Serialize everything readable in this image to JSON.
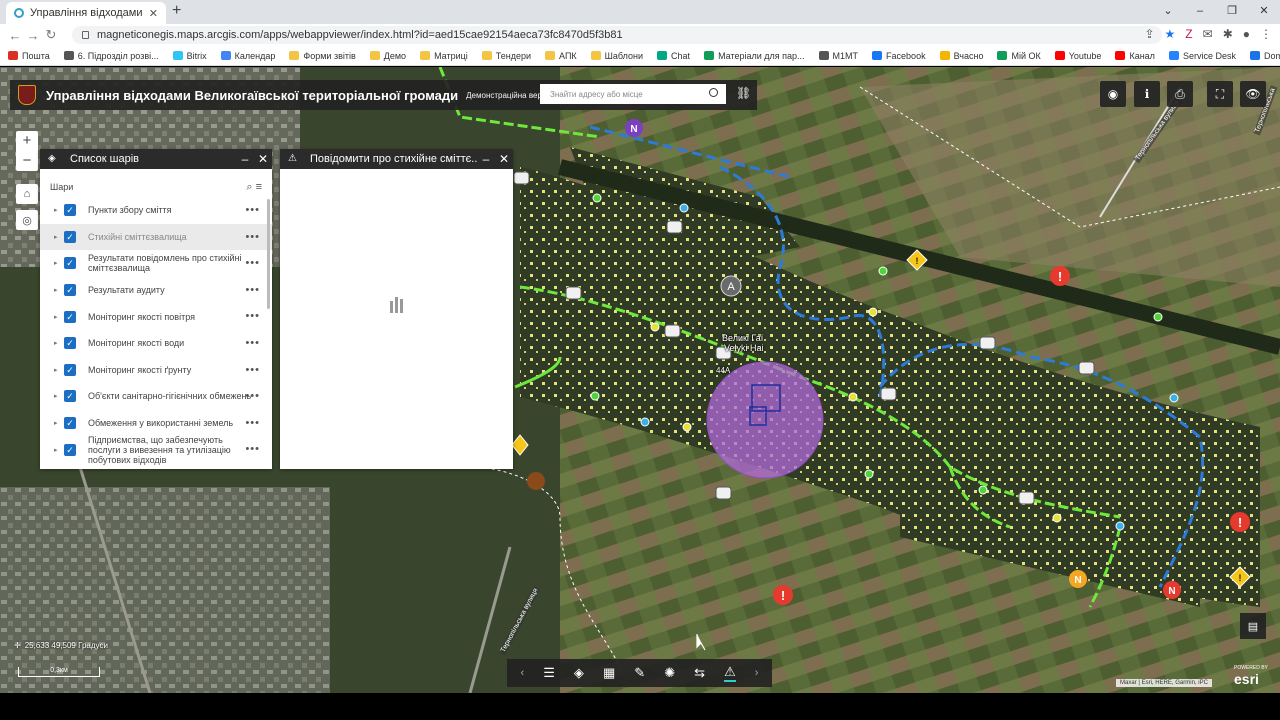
{
  "browser": {
    "tab_title": "Управління відходами Великога",
    "url": "magneticonegis.maps.arcgis.com/apps/webappviewer/index.html?id=aed15cae92154aeca73fc8470d5f3b81",
    "bookmarks": [
      {
        "label": "Пошта",
        "color": "#d93025"
      },
      {
        "label": "6. Підрозділ розві...",
        "color": "#555"
      },
      {
        "label": "Bitrix",
        "color": "#2fc6f6"
      },
      {
        "label": "Календар",
        "color": "#4285f4"
      },
      {
        "label": "Форми звітів",
        "color": "#f4c542"
      },
      {
        "label": "Демо",
        "color": "#f4c542"
      },
      {
        "label": "Матриці",
        "color": "#f4c542"
      },
      {
        "label": "Тендери",
        "color": "#f4c542"
      },
      {
        "label": "АПК",
        "color": "#f4c542"
      },
      {
        "label": "Шаблони",
        "color": "#f4c542"
      },
      {
        "label": "Chat",
        "color": "#00a884"
      },
      {
        "label": "Матеріали для пар...",
        "color": "#0f9d58"
      },
      {
        "label": "M1MT",
        "color": "#555"
      },
      {
        "label": "Facebook",
        "color": "#1877f2"
      },
      {
        "label": "Вчасно",
        "color": "#f4b400"
      },
      {
        "label": "Мій ОК",
        "color": "#0f9d58"
      },
      {
        "label": "Youtube",
        "color": "#ff0000"
      },
      {
        "label": "Канал",
        "color": "#ff0000"
      },
      {
        "label": "Service Desk",
        "color": "#2684ff"
      },
      {
        "label": "Domoticz",
        "color": "#1a73e8"
      }
    ]
  },
  "app": {
    "title": "Управління відходами Великогаївської територіальної громади",
    "subtitle": "Демонстраційна версія",
    "search_placeholder": "Знайти адресу або місце"
  },
  "layer_panel": {
    "title": "Список шарів",
    "section_label": "Шари",
    "layers": [
      {
        "label": "Пункти збору сміття",
        "dim": false
      },
      {
        "label": "Стихійні сміттєзвалища",
        "dim": true
      },
      {
        "label": "Результати повідомлень про стихійні сміттєзвалища",
        "dim": false
      },
      {
        "label": "Результати аудиту",
        "dim": false
      },
      {
        "label": "Моніторинг якості повітря",
        "dim": false
      },
      {
        "label": "Моніторинг якості води",
        "dim": false
      },
      {
        "label": "Моніторинг якості ґрунту",
        "dim": false
      },
      {
        "label": "Об'єкти санітарно-гігієнічних обмежень",
        "dim": false
      },
      {
        "label": "Обмеження у використанні земель",
        "dim": false
      },
      {
        "label": "Підприємства, що забезпечують послуги з вивезення та утилізацію побутових відходів",
        "dim": false
      }
    ]
  },
  "report_panel": {
    "title": "Повідомити про стихійне сміттє..."
  },
  "map": {
    "place_label_ua": "Великі Гаї",
    "place_label_en": "Velyki Hai",
    "building_label": "44А",
    "road_label_1": "Тернопільська вулиця",
    "road_label_2": "Тернопільська вулиця",
    "road_label_3": "Тернопільська",
    "coords": "25,633 49,509 Градуси",
    "scale": "0,3км",
    "attribution": "Maxar | Esri, HERE, Garmin, iPC",
    "esri_powered": "POWERED BY",
    "esri_logo": "esri",
    "colors": {
      "trash_marker": "#f0f0f0",
      "warning": "#e63a2e",
      "caution": "#f5c518",
      "route_blue": "#2d7bd8",
      "route_green": "#6ee83c",
      "buffer": "#b06ad8"
    }
  }
}
